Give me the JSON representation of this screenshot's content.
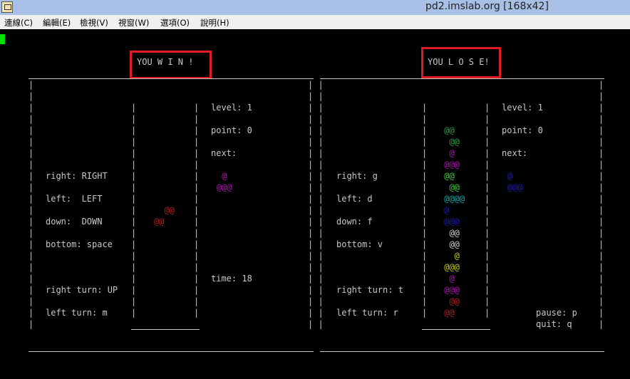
{
  "window": {
    "title": "pd2.imslab.org [168x42]",
    "app_icon": "putty-terminal-icon"
  },
  "menu": [
    "連線(C)",
    "編輯(E)",
    "檢視(V)",
    "視窗(W)",
    "選項(O)",
    "說明(H)"
  ],
  "colors": {
    "green": "#2ea043",
    "lime": "#3fcf3f",
    "magenta": "#b012b0",
    "cyan": "#14a5a5",
    "blue": "#1e1eb4",
    "red": "#b41e1e",
    "white": "#d0d0d0",
    "yellow": "#c8c81e",
    "box": "#e01b24"
  },
  "left": {
    "result": "YOU W I N !",
    "controls": [
      "right: RIGHT",
      "left:  LEFT",
      "down:  DOWN",
      "bottom: space",
      "right turn: UP",
      "left turn: m"
    ],
    "level": "level: 1",
    "point": "point: 0",
    "next_label": "next:",
    "next_piece": [
      " @",
      "@@@"
    ],
    "falling_piece": [
      "  @@",
      "@@"
    ],
    "time": "time: 18"
  },
  "right": {
    "result": "YOU L O S E!",
    "controls": [
      "right: g",
      "left: d",
      "down: f",
      "bottom: v",
      "right turn: t",
      "left turn: r"
    ],
    "level": "level: 1",
    "point": "point: 0",
    "next_label": "next:",
    "next_piece": [
      "@",
      "@@@"
    ],
    "stack": [
      " @@",
      "  @@",
      "  @",
      " @@@",
      " @@",
      "  @@",
      " @@@@",
      " @",
      " @@@",
      "  @@",
      "  @@",
      "   @",
      " @@@",
      "  @",
      " @@@",
      "  @@",
      " @@"
    ],
    "pause": "pause: p",
    "quit": "quit: q"
  }
}
